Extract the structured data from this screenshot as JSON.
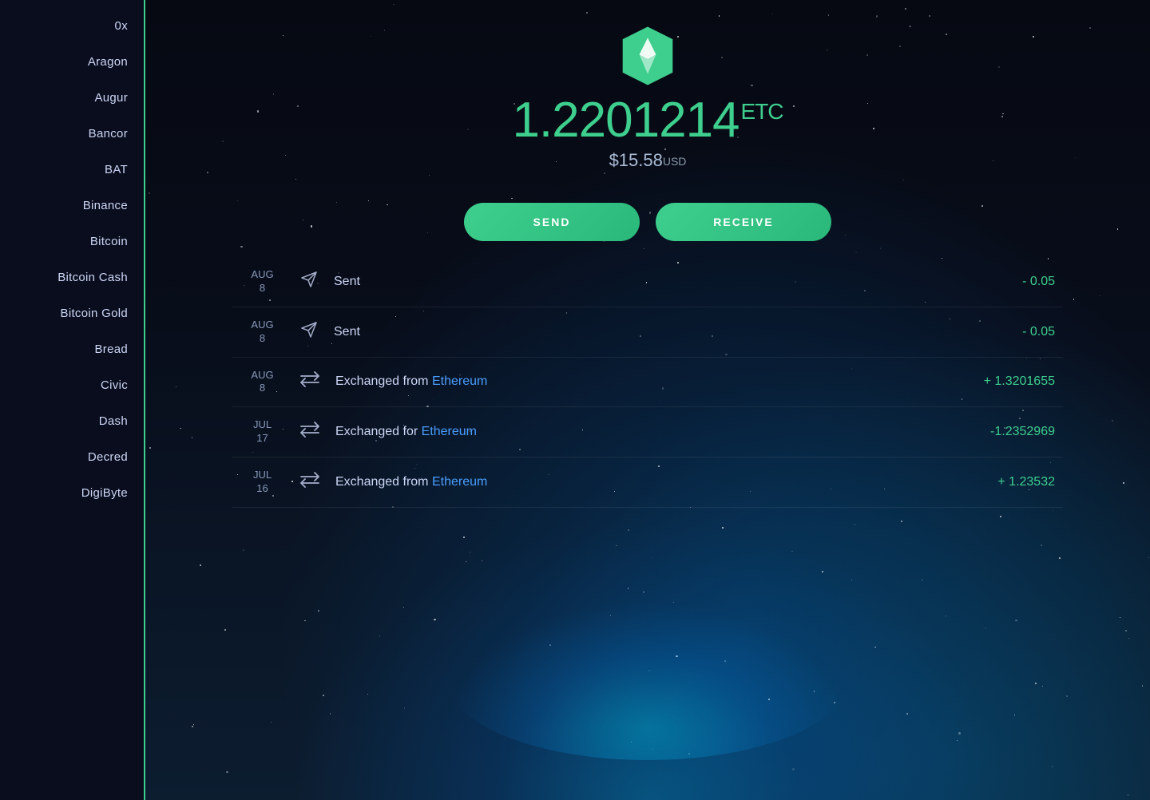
{
  "sidebar": {
    "items": [
      {
        "label": "0x",
        "id": "0x"
      },
      {
        "label": "Aragon",
        "id": "aragon"
      },
      {
        "label": "Augur",
        "id": "augur"
      },
      {
        "label": "Bancor",
        "id": "bancor"
      },
      {
        "label": "BAT",
        "id": "bat"
      },
      {
        "label": "Binance",
        "id": "binance"
      },
      {
        "label": "Bitcoin",
        "id": "bitcoin"
      },
      {
        "label": "Bitcoin Cash",
        "id": "bitcoin-cash"
      },
      {
        "label": "Bitcoin Gold",
        "id": "bitcoin-gold"
      },
      {
        "label": "Bread",
        "id": "bread"
      },
      {
        "label": "Civic",
        "id": "civic"
      },
      {
        "label": "Dash",
        "id": "dash"
      },
      {
        "label": "Decred",
        "id": "decred"
      },
      {
        "label": "DigiByte",
        "id": "digibyte"
      }
    ]
  },
  "coin": {
    "symbol": "ETC",
    "balance": "1.2201214",
    "usd_price": "$15.58",
    "usd_label": "USD",
    "send_label": "SEND",
    "receive_label": "RECEIVE"
  },
  "transactions": [
    {
      "month": "AUG",
      "day": "8",
      "type": "sent",
      "description": "Sent",
      "link": null,
      "amount": "- 0.05",
      "positive": false
    },
    {
      "month": "AUG",
      "day": "8",
      "type": "sent",
      "description": "Sent",
      "link": null,
      "amount": "- 0.05",
      "positive": false
    },
    {
      "month": "AUG",
      "day": "8",
      "type": "exchange",
      "description": "Exchanged from",
      "link": "Ethereum",
      "amount": "+ 1.3201655",
      "positive": true
    },
    {
      "month": "JUL",
      "day": "17",
      "type": "exchange",
      "description": "Exchanged for",
      "link": "Ethereum",
      "amount": "-1.2352969",
      "positive": false
    },
    {
      "month": "JUL",
      "day": "16",
      "type": "exchange",
      "description": "Exchanged from",
      "link": "Ethereum",
      "amount": "+ 1.23532",
      "positive": true
    }
  ],
  "icons": {
    "sent": "✈",
    "exchange": "⇄"
  }
}
